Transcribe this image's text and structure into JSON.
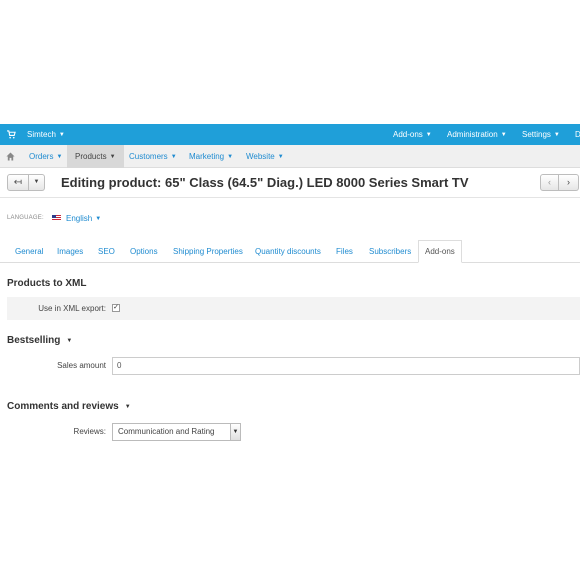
{
  "topbar": {
    "brand": "Simtech",
    "menus": [
      "Add-ons",
      "Administration",
      "Settings",
      "D"
    ]
  },
  "navbar": {
    "items": [
      "Orders",
      "Products",
      "Customers",
      "Marketing",
      "Website"
    ],
    "active": "Products"
  },
  "titlebar": {
    "title": "Editing product: 65\" Class (64.5\" Diag.) LED 8000 Series Smart TV"
  },
  "language": {
    "label": "LANGUAGE:",
    "value": "English"
  },
  "tabs": {
    "items": [
      "General",
      "Images",
      "SEO",
      "Options",
      "Shipping Properties",
      "Quantity discounts",
      "Files",
      "Subscribers",
      "Add-ons"
    ],
    "active": "Add-ons"
  },
  "products_to_xml": {
    "title": "Products to XML",
    "field_label": "Use in XML export:",
    "checked": true
  },
  "bestselling": {
    "title": "Bestselling",
    "field_label": "Sales amount",
    "value": "0"
  },
  "comments": {
    "title": "Comments and reviews",
    "field_label": "Reviews:",
    "selected": "Communication and Rating"
  },
  "colors": {
    "topbar": "#1f9fd9",
    "link": "#1f8bd0",
    "navbar": "#f0f0f0"
  }
}
